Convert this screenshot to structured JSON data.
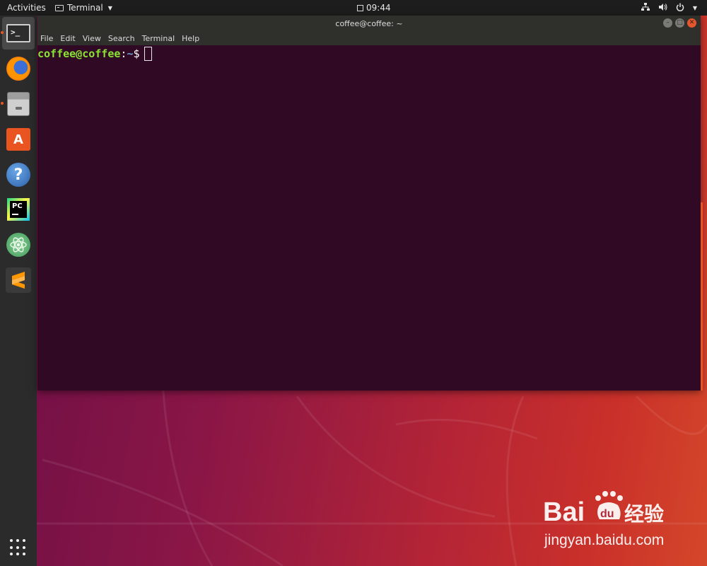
{
  "topbar": {
    "activities": "Activities",
    "app_menu": "Terminal",
    "time": "09:44"
  },
  "dock": {
    "items": [
      {
        "name": "Terminal",
        "icon": "terminal-icon",
        "active": true,
        "running": true
      },
      {
        "name": "Firefox Web Browser",
        "icon": "firefox-icon",
        "running": false
      },
      {
        "name": "Files",
        "icon": "files-icon",
        "running": true
      },
      {
        "name": "Ubuntu Software",
        "icon": "software-store-icon",
        "running": false
      },
      {
        "name": "Help",
        "icon": "help-icon",
        "running": false
      },
      {
        "name": "PyCharm",
        "icon": "pycharm-icon",
        "running": false
      },
      {
        "name": "Atom",
        "icon": "atom-icon",
        "running": false
      },
      {
        "name": "Sublime Text",
        "icon": "sublime-icon",
        "running": false
      }
    ],
    "terminal_glyph": ">_",
    "pycharm_glyph": "PC",
    "store_glyph": "A",
    "help_glyph": "?"
  },
  "terminal": {
    "title": "coffee@coffee: ~",
    "menu": [
      "File",
      "Edit",
      "View",
      "Search",
      "Terminal",
      "Help"
    ],
    "prompt_user": "coffee@coffee",
    "prompt_sep": ":",
    "prompt_path": "~",
    "prompt_symbol": "$"
  },
  "watermark": {
    "url": "jingyan.baidu.com"
  },
  "colors": {
    "terminal_bg": "#300a24",
    "prompt_user": "#8ae234",
    "prompt_path": "#729fcf",
    "accent": "#e95420"
  }
}
